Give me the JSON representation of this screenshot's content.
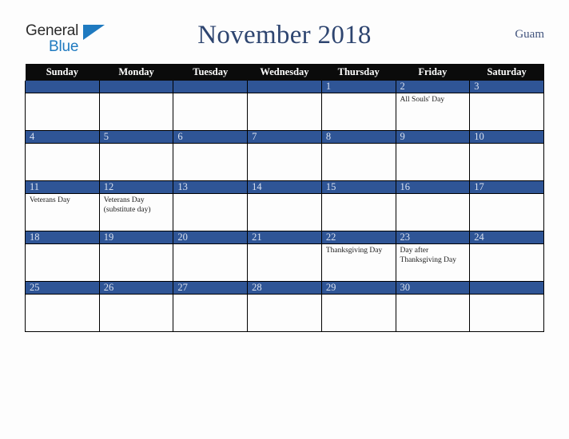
{
  "brand": {
    "name_part1": "General",
    "name_part2": "Blue",
    "triangle_color": "#1f7ac0",
    "text_color": "#2b2b2b"
  },
  "header": {
    "title": "November 2018",
    "country": "Guam",
    "title_color": "#2e4570"
  },
  "calendar": {
    "weekday_headers": [
      "Sunday",
      "Monday",
      "Tuesday",
      "Wednesday",
      "Thursday",
      "Friday",
      "Saturday"
    ],
    "header_bg": "#0b0b0b",
    "daynum_bg": "#2f5596",
    "daynum_color": "#d8e0ef",
    "weeks": [
      [
        {
          "date": "",
          "events": []
        },
        {
          "date": "",
          "events": []
        },
        {
          "date": "",
          "events": []
        },
        {
          "date": "",
          "events": []
        },
        {
          "date": "1",
          "events": []
        },
        {
          "date": "2",
          "events": [
            "All Souls' Day"
          ]
        },
        {
          "date": "3",
          "events": []
        }
      ],
      [
        {
          "date": "4",
          "events": []
        },
        {
          "date": "5",
          "events": []
        },
        {
          "date": "6",
          "events": []
        },
        {
          "date": "7",
          "events": []
        },
        {
          "date": "8",
          "events": []
        },
        {
          "date": "9",
          "events": []
        },
        {
          "date": "10",
          "events": []
        }
      ],
      [
        {
          "date": "11",
          "events": [
            "Veterans Day"
          ]
        },
        {
          "date": "12",
          "events": [
            "Veterans Day (substitute day)"
          ]
        },
        {
          "date": "13",
          "events": []
        },
        {
          "date": "14",
          "events": []
        },
        {
          "date": "15",
          "events": []
        },
        {
          "date": "16",
          "events": []
        },
        {
          "date": "17",
          "events": []
        }
      ],
      [
        {
          "date": "18",
          "events": []
        },
        {
          "date": "19",
          "events": []
        },
        {
          "date": "20",
          "events": []
        },
        {
          "date": "21",
          "events": []
        },
        {
          "date": "22",
          "events": [
            "Thanksgiving Day"
          ]
        },
        {
          "date": "23",
          "events": [
            "Day after Thanksgiving Day"
          ]
        },
        {
          "date": "24",
          "events": []
        }
      ],
      [
        {
          "date": "25",
          "events": []
        },
        {
          "date": "26",
          "events": []
        },
        {
          "date": "27",
          "events": []
        },
        {
          "date": "28",
          "events": []
        },
        {
          "date": "29",
          "events": []
        },
        {
          "date": "30",
          "events": []
        },
        {
          "date": "",
          "events": []
        }
      ]
    ]
  }
}
